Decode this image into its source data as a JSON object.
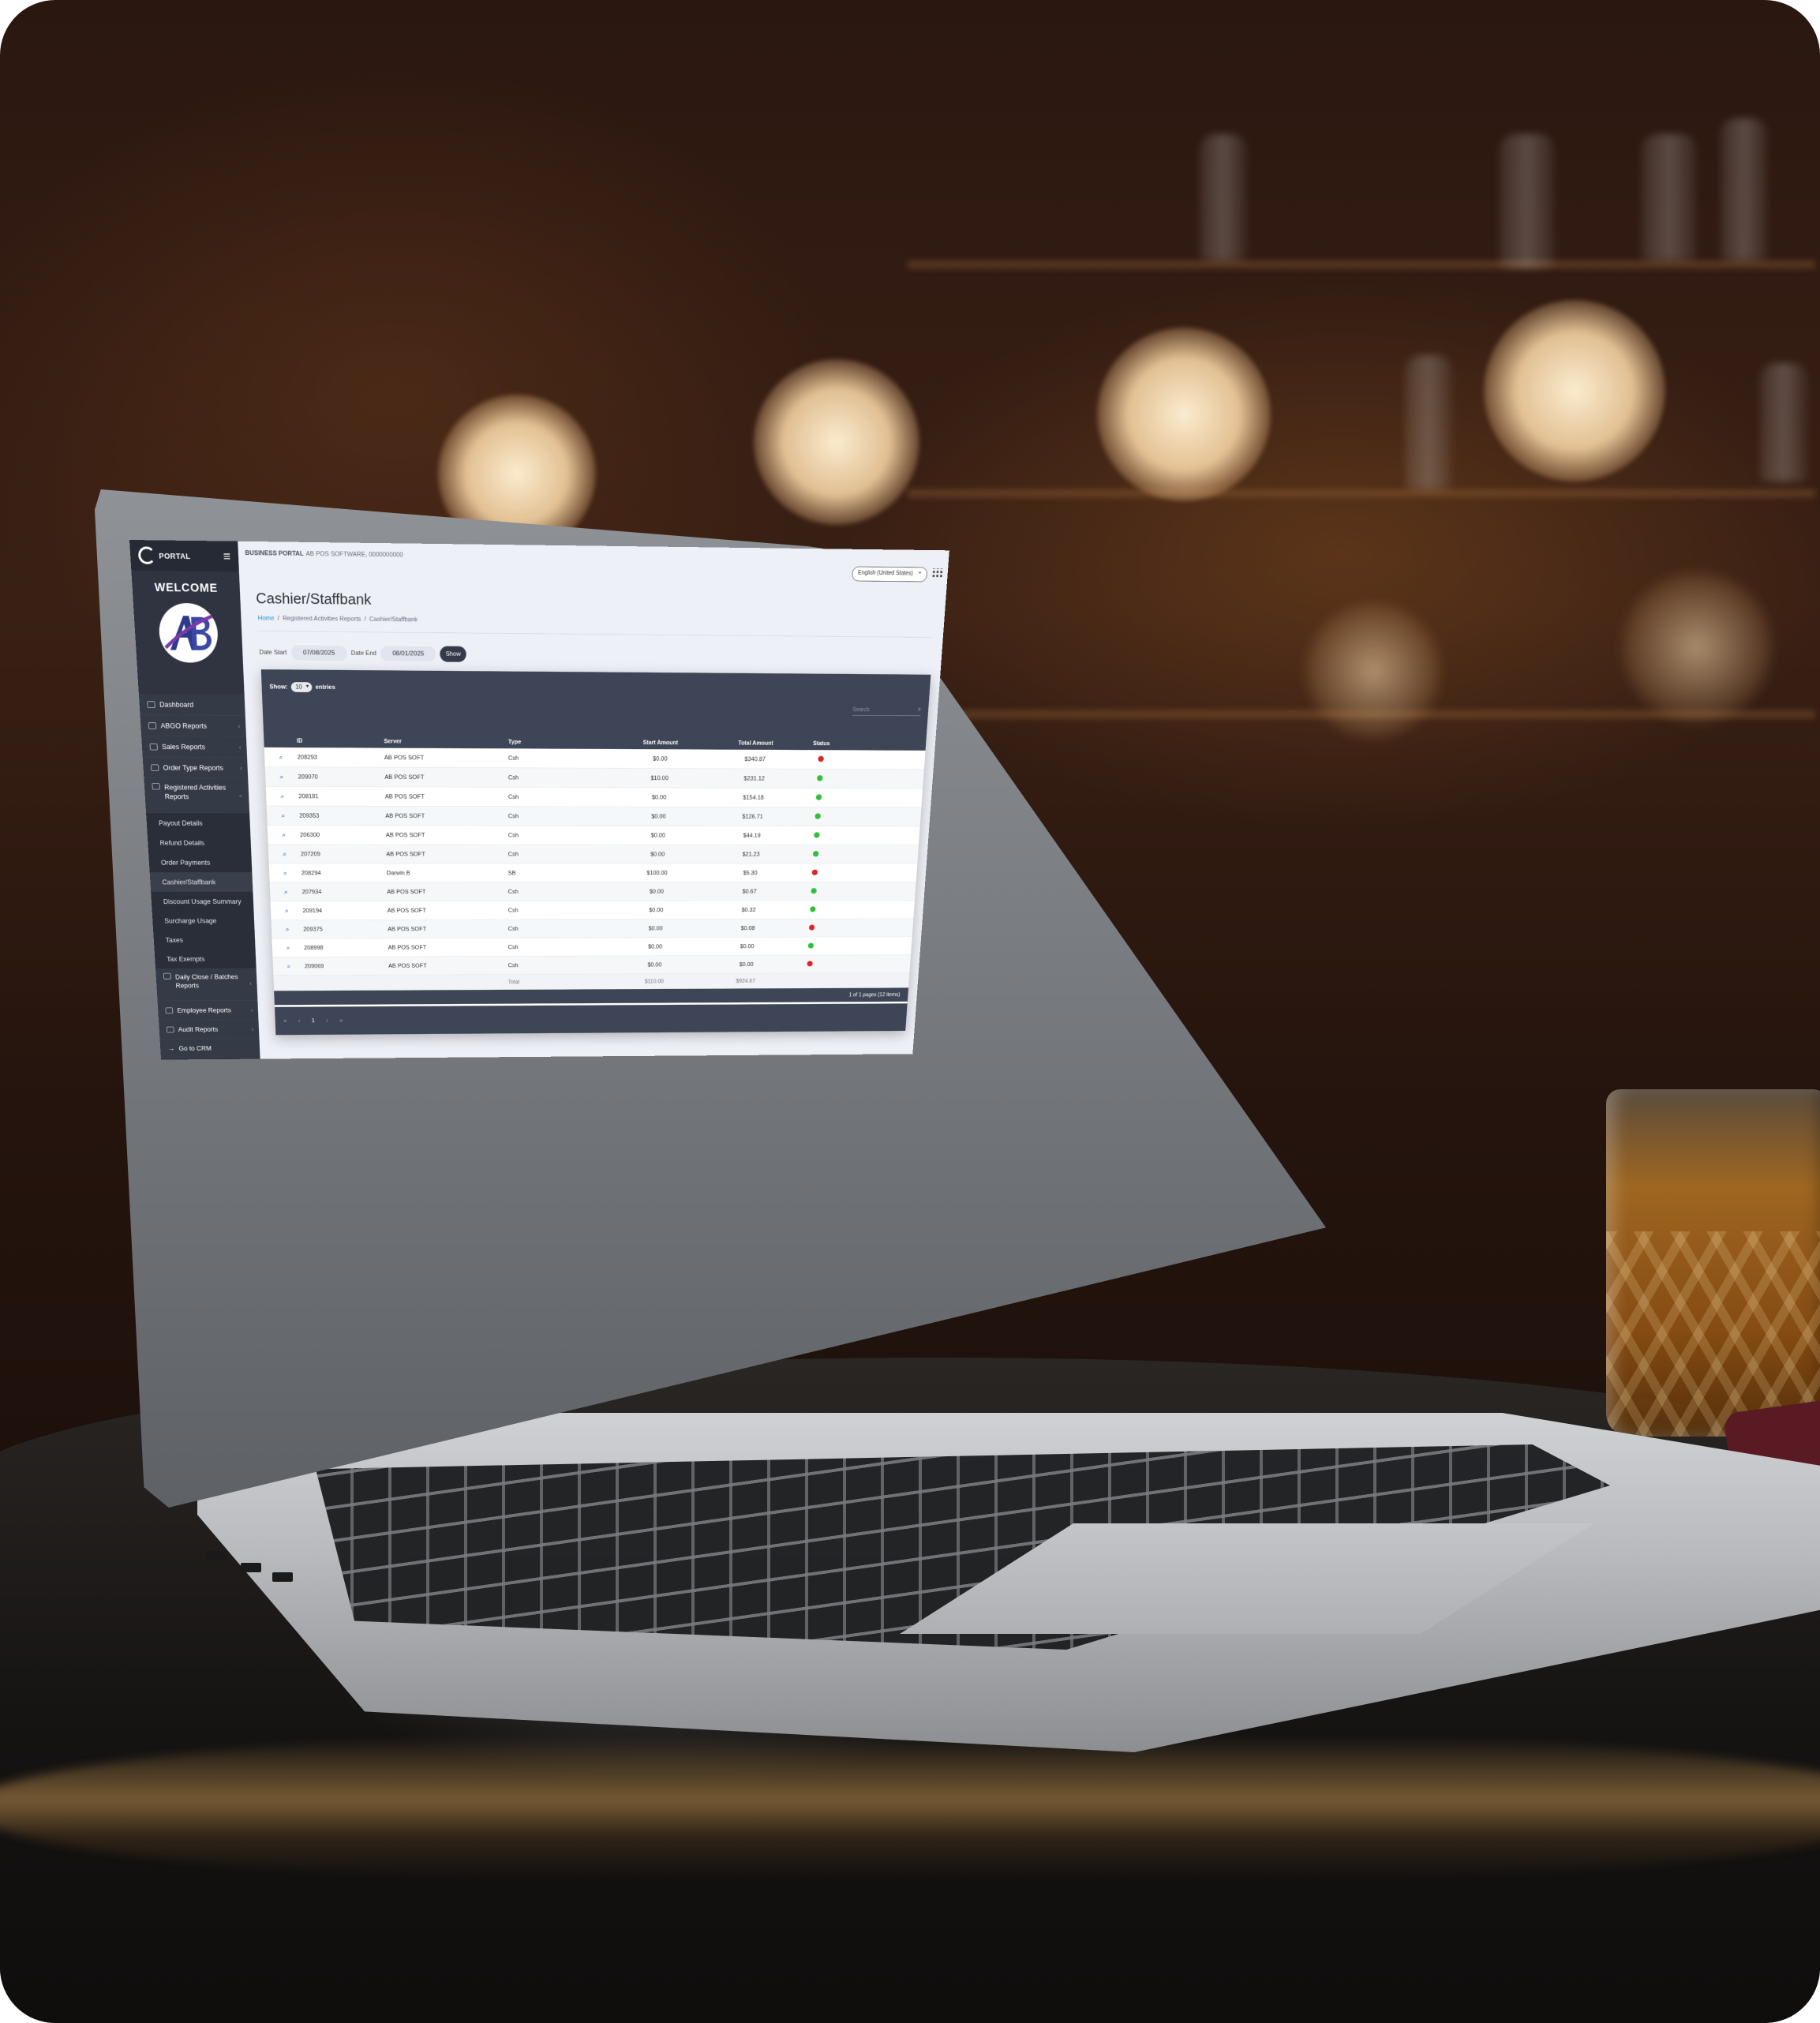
{
  "app": {
    "logo_text": "PORTAL",
    "welcome": "WELCOME",
    "topbar_brand": "BUSINESS PORTAL",
    "topbar_company": "AB POS SOFTWARE, 0000000000",
    "language": "English (United States)"
  },
  "sidebar": {
    "items": [
      {
        "label": "Dashboard",
        "icon": "dashboard-icon"
      },
      {
        "label": "ABGO Reports",
        "icon": "report-icon"
      },
      {
        "label": "Sales Reports",
        "icon": "sales-icon"
      },
      {
        "label": "Order Type Reports",
        "icon": "list-icon"
      },
      {
        "label": "Registered Activities Reports",
        "icon": "register-icon"
      }
    ],
    "subitems": [
      "Payout Details",
      "Refund Details",
      "Order Payments",
      "Cashier/Staffbank",
      "Discount Usage Summary",
      "Surcharge Usage",
      "Taxes",
      "Tax Exempts"
    ],
    "bottom_items": [
      {
        "label": "Daily Close / Batches Reports",
        "icon": "batch-icon"
      },
      {
        "label": "Employee Reports",
        "icon": "employee-icon"
      },
      {
        "label": "Audit Reports",
        "icon": "audit-icon"
      },
      {
        "label": "Go to CRM",
        "icon": "arrow-right-icon"
      }
    ]
  },
  "page": {
    "title": "Cashier/Staffbank",
    "breadcrumb": {
      "home": "Home",
      "section": "Registered Activities Reports",
      "current": "Cashier/Staffbank"
    },
    "filters": {
      "date_start_label": "Date Start",
      "date_start": "07/08/2025",
      "date_end_label": "Date End",
      "date_end": "08/01/2025",
      "show_label": "Show"
    }
  },
  "table": {
    "show_label": "Show:",
    "entries_value": "10",
    "entries_label": "entries",
    "search_placeholder": "Search",
    "headers": {
      "id": "ID",
      "server": "Server",
      "type": "Type",
      "start": "Start Amount",
      "total": "Total Amount",
      "status": "Status"
    },
    "rows": [
      {
        "id": "208293",
        "server": "AB POS SOFT",
        "type": "Csh",
        "start": "$0.00",
        "total": "$340.87",
        "status": "red"
      },
      {
        "id": "209070",
        "server": "AB POS SOFT",
        "type": "Csh",
        "start": "$10.00",
        "total": "$231.12",
        "status": "green"
      },
      {
        "id": "208181",
        "server": "AB POS SOFT",
        "type": "Csh",
        "start": "$0.00",
        "total": "$154.18",
        "status": "green"
      },
      {
        "id": "209353",
        "server": "AB POS SOFT",
        "type": "Csh",
        "start": "$0.00",
        "total": "$126.71",
        "status": "green"
      },
      {
        "id": "206300",
        "server": "AB POS SOFT",
        "type": "Csh",
        "start": "$0.00",
        "total": "$44.19",
        "status": "green"
      },
      {
        "id": "207209",
        "server": "AB POS SOFT",
        "type": "Csh",
        "start": "$0.00",
        "total": "$21.23",
        "status": "green"
      },
      {
        "id": "208294",
        "server": "Darwin B",
        "type": "SB",
        "start": "$100.00",
        "total": "$5.30",
        "status": "red"
      },
      {
        "id": "207934",
        "server": "AB POS SOFT",
        "type": "Csh",
        "start": "$0.00",
        "total": "$0.67",
        "status": "green"
      },
      {
        "id": "209194",
        "server": "AB POS SOFT",
        "type": "Csh",
        "start": "$0.00",
        "total": "$0.32",
        "status": "green"
      },
      {
        "id": "209375",
        "server": "AB POS SOFT",
        "type": "Csh",
        "start": "$0.00",
        "total": "$0.08",
        "status": "red"
      },
      {
        "id": "208998",
        "server": "AB POS SOFT",
        "type": "Csh",
        "start": "$0.00",
        "total": "$0.00",
        "status": "green"
      },
      {
        "id": "209069",
        "server": "AB POS SOFT",
        "type": "Csh",
        "start": "$0.00",
        "total": "$0.00",
        "status": "red"
      }
    ],
    "total_label": "Total",
    "total_start": "$110.00",
    "total_amount": "$924.67",
    "pages_info": "1 of 1 pages (12 items)",
    "current_page": "1"
  },
  "colors": {
    "red": "#d8262b",
    "green": "#2fbf3a",
    "sidebar": "#2f3440",
    "header": "#3e4556"
  }
}
